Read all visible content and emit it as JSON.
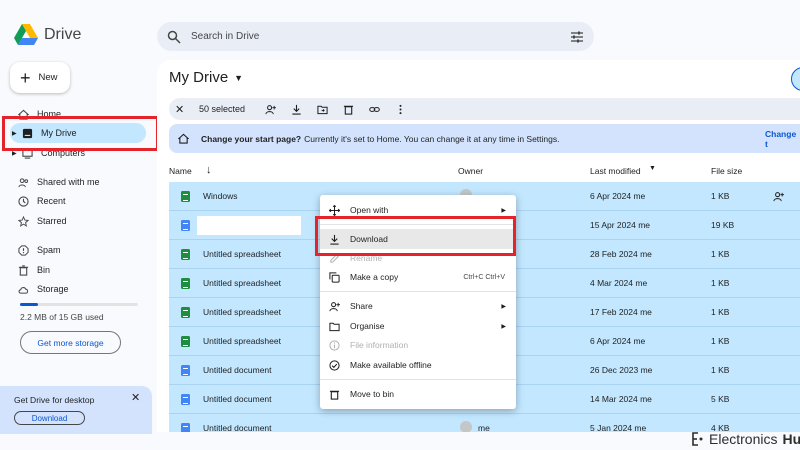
{
  "app": {
    "name": "Drive"
  },
  "search": {
    "placeholder": "Search in Drive"
  },
  "sidebar": {
    "new_label": "New",
    "items": [
      {
        "label": "Home",
        "icon": "home-icon"
      },
      {
        "label": "My Drive",
        "icon": "drive-icon",
        "active": true
      },
      {
        "label": "Computers",
        "icon": "computer-icon"
      },
      {
        "label": "Shared with me",
        "icon": "people-icon"
      },
      {
        "label": "Recent",
        "icon": "clock-icon"
      },
      {
        "label": "Starred",
        "icon": "star-icon"
      },
      {
        "label": "Spam",
        "icon": "spam-icon"
      },
      {
        "label": "Bin",
        "icon": "bin-icon"
      },
      {
        "label": "Storage",
        "icon": "cloud-icon"
      }
    ],
    "storage_used_fraction": 0.15,
    "storage_text": "2.2 MB of 15 GB used",
    "get_more_storage": "Get more storage",
    "desktop_card": {
      "title": "Get Drive for desktop",
      "download": "Download"
    }
  },
  "main": {
    "title": "My Drive",
    "selection": {
      "count": "50 selected"
    },
    "banner": {
      "bold": "Change your start page?",
      "text": "Currently it's set to Home. You can change it at any time in Settings.",
      "cta": "Change t"
    },
    "columns": {
      "name": "Name",
      "owner": "Owner",
      "modified": "Last modified",
      "size": "File size"
    },
    "rows": [
      {
        "type": "sheet",
        "name": "Windows",
        "owner": "",
        "modified": "6 Apr 2024  me",
        "size": "1 KB"
      },
      {
        "type": "doc",
        "name": "",
        "owner": "",
        "modified": "15 Apr 2024  me",
        "size": "19 KB"
      },
      {
        "type": "sheet",
        "name": "Untitled spreadsheet",
        "owner": "",
        "modified": "28 Feb 2024  me",
        "size": "1 KB"
      },
      {
        "type": "sheet",
        "name": "Untitled spreadsheet",
        "owner": "",
        "modified": "4 Mar 2024  me",
        "size": "1 KB"
      },
      {
        "type": "sheet",
        "name": "Untitled spreadsheet",
        "owner": "",
        "modified": "17 Feb 2024  me",
        "size": "1 KB"
      },
      {
        "type": "sheet",
        "name": "Untitled spreadsheet",
        "owner": "",
        "modified": "6 Apr 2024  me",
        "size": "1 KB"
      },
      {
        "type": "doc",
        "name": "Untitled document",
        "owner": "",
        "modified": "26 Dec 2023  me",
        "size": "1 KB"
      },
      {
        "type": "doc",
        "name": "Untitled document",
        "owner": "",
        "modified": "14 Mar 2024  me",
        "size": "5 KB"
      },
      {
        "type": "doc",
        "name": "Untitled document",
        "owner": "me",
        "modified": "5 Jan 2024  me",
        "size": "4 KB"
      }
    ]
  },
  "context_menu": {
    "items": [
      {
        "label": "Open with",
        "icon": "move-icon",
        "arrow": true
      },
      {
        "label": "Download",
        "icon": "download-icon",
        "hover": true
      },
      {
        "label": "Rename",
        "icon": "rename-icon",
        "disabled": true
      },
      {
        "label": "Make a copy",
        "icon": "copy-icon",
        "kbd": "Ctrl+C Ctrl+V"
      },
      {
        "label": "Share",
        "icon": "share-icon",
        "arrow": true
      },
      {
        "label": "Organise",
        "icon": "folder-icon",
        "arrow": true
      },
      {
        "label": "File information",
        "icon": "info-icon",
        "disabled": true
      },
      {
        "label": "Make available offline",
        "icon": "offline-icon"
      },
      {
        "label": "Move to bin",
        "icon": "bin-icon"
      }
    ]
  },
  "watermark": {
    "text_a": "Electronics",
    "text_b": "Hub"
  },
  "colors": {
    "accent": "#0b57d0",
    "selected": "#c2e7ff",
    "highlight": "#e4232b"
  }
}
